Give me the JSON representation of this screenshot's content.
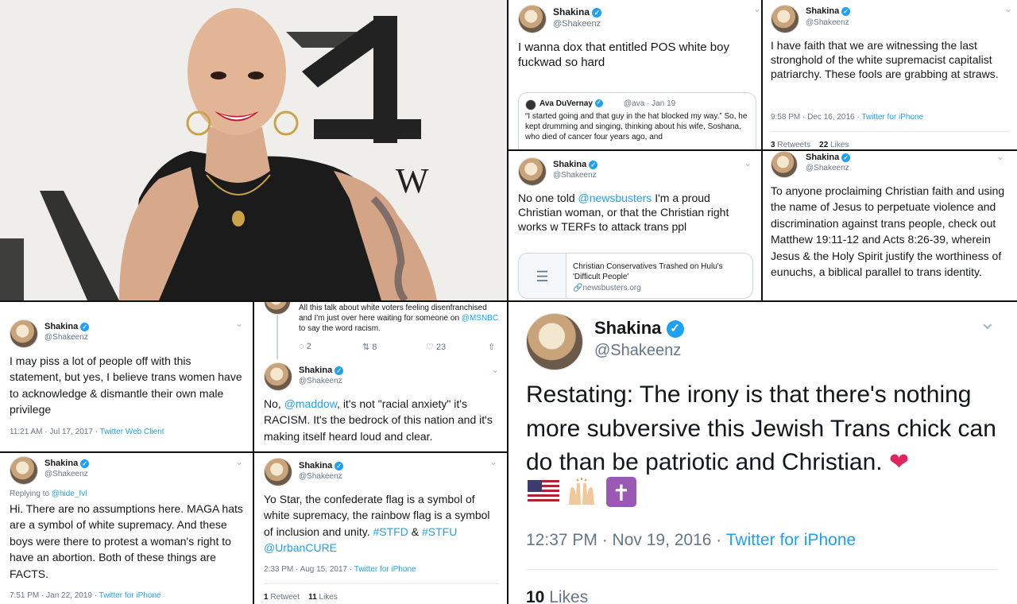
{
  "photo": {
    "wall_letters": "W"
  },
  "accent": "#1da1f2",
  "tweets": {
    "t1": {
      "name": "Shakina",
      "handle": "@Shakeenz",
      "text": "I wanna dox that entitled POS white boy fuckwad so hard",
      "quote": {
        "name": "Ava DuVernay",
        "handle": "@ava",
        "date": "· Jan 19",
        "text": "“I started going and that guy in the hat blocked my way.” So, he kept drumming and singing, thinking about his wife, Soshana, who died of cancer four years ago, and"
      }
    },
    "t2": {
      "name": "Shakina",
      "handle": "@Shakeenz",
      "text": "I have faith that we are witnessing the last stronghold of the white supremacist capitalist patriarchy. These fools are grabbing at straws.",
      "time": "9:58 PM · Dec 16, 2016 · ",
      "source": "Twitter for iPhone",
      "retweets": "3",
      "retweets_label": " Retweets",
      "likes": "22",
      "likes_label": " Likes"
    },
    "t3": {
      "name": "Shakina",
      "handle": "@Shakeenz",
      "text_pre": "No one told ",
      "mention": "@newsbusters",
      "text_post": " I'm a proud Christian woman, or that the Christian right works w TERFs to attack trans ppl",
      "card": {
        "title": "Christian Conservatives Trashed on Hulu's 'Difficult People'",
        "domain": "newsbusters.org"
      }
    },
    "t4": {
      "name": "Shakina",
      "handle": "@Shakeenz",
      "text": "To anyone proclaiming Christian faith and using the name of Jesus to perpetuate violence and discrimination against trans people, check out Matthew 19:11-12 and Acts 8:26-39, wherein Jesus & the Holy Spirit justify the worthiness of eunuchs, a biblical parallel to trans identity."
    },
    "t5": {
      "name": "Shakina",
      "handle": "@Shakeenz",
      "text": "I may piss a lot of people off with this statement, but yes, I believe trans women have to acknowledge & dismantle their own male privilege",
      "time": "11:21 AM · Jul 17, 2017 · ",
      "source": "Twitter Web Client"
    },
    "t6": {
      "parent_text": "All this talk about white voters feeling disenfranchised and I'm just over here waiting for someone on ",
      "parent_mention": "@MSNBC",
      "parent_post": " to say the word racism.",
      "replies": "2",
      "retweets": "8",
      "likes": "23",
      "name": "Shakina",
      "handle": "@Shakeenz",
      "text_pre": "No, ",
      "mention": "@maddow",
      "text_post": ", it's not \"racial anxiety\" it's RACISM. It's the bedrock of this nation and it's making itself heard loud and clear."
    },
    "t7": {
      "name": "Shakina",
      "handle": "@Shakeenz",
      "reply_label": "Replying to ",
      "reply_to": "@hide_fvl",
      "text": "Hi. There are no assumptions here. MAGA hats are a symbol of white supremacy. And these boys were there to protest a woman's right to have an abortion. Both of these things are FACTS.",
      "time": "7:51 PM · Jan 22, 2019 · ",
      "source": "Twitter for iPhone"
    },
    "t8": {
      "name": "Shakina",
      "handle": "@Shakeenz",
      "text_pre": "Yo Star, the confederate flag is a symbol of white supremacy, the rainbow flag is a symbol of inclusion and unity. ",
      "tag1": "#STFD",
      "amp": " & ",
      "tag2": "#STFU",
      "space": " ",
      "mention": "@UrbanCURE",
      "time": "2:33 PM · Aug 15, 2017 · ",
      "source": "Twitter for iPhone",
      "retweets": "1",
      "retweets_label": " Retweet",
      "likes": "11",
      "likes_label": " Likes"
    },
    "t9": {
      "name": "Shakina",
      "handle": "@Shakeenz",
      "text": "Restating: The irony is that there's nothing more subversive this Jewish Trans chick can do than be patriotic and Christian.",
      "emoji_heart": "❤",
      "emoji_cross": "✝",
      "time": "12:37 PM · Nov 19, 2016 · ",
      "source": "Twitter for iPhone",
      "likes": "10",
      "likes_label": " Likes"
    }
  }
}
